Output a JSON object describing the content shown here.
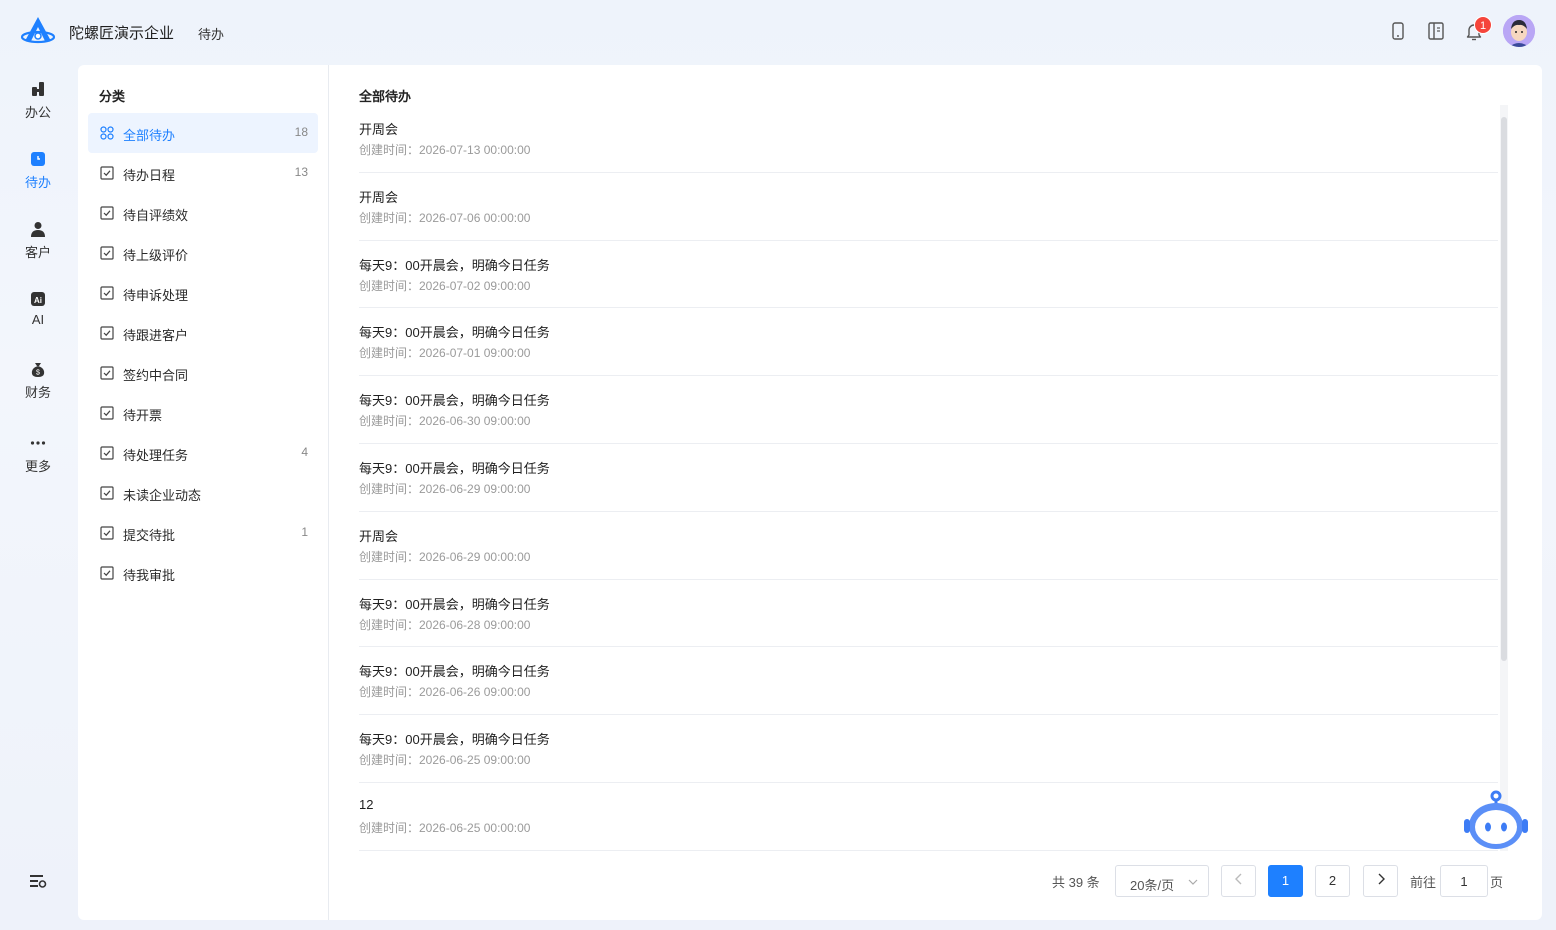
{
  "header": {
    "company": "陀螺匠演示企业",
    "breadcrumb": "待办",
    "notification_count": "1",
    "icons": [
      "phone-icon",
      "book-icon",
      "bell-icon"
    ]
  },
  "sidebar": {
    "items": [
      {
        "label": "办公",
        "icon": "office-icon"
      },
      {
        "label": "待办",
        "icon": "todo-icon",
        "active": true
      },
      {
        "label": "客户",
        "icon": "customer-icon"
      },
      {
        "label": "AI",
        "icon": "ai-icon"
      },
      {
        "label": "财务",
        "icon": "finance-icon"
      },
      {
        "label": "更多",
        "icon": "more-icon"
      }
    ]
  },
  "categories": {
    "title": "分类",
    "items": [
      {
        "label": "全部待办",
        "count": "18",
        "active": true
      },
      {
        "label": "待办日程",
        "count": "13"
      },
      {
        "label": "待自评绩效",
        "count": ""
      },
      {
        "label": "待上级评价",
        "count": ""
      },
      {
        "label": "待申诉处理",
        "count": ""
      },
      {
        "label": "待跟进客户",
        "count": ""
      },
      {
        "label": "签约中合同",
        "count": ""
      },
      {
        "label": "待开票",
        "count": ""
      },
      {
        "label": "待处理任务",
        "count": "4"
      },
      {
        "label": "未读企业动态",
        "count": ""
      },
      {
        "label": "提交待批",
        "count": "1"
      },
      {
        "label": "待我审批",
        "count": ""
      }
    ]
  },
  "todo_list": {
    "title": "全部待办",
    "items": [
      {
        "title": "开周会",
        "time": "创建时间：2026-07-13 00:00:00"
      },
      {
        "title": "开周会",
        "time": "创建时间：2026-07-06 00:00:00"
      },
      {
        "title": "每天9：00开晨会，明确今日任务",
        "time": "创建时间：2026-07-02 09:00:00"
      },
      {
        "title": "每天9：00开晨会，明确今日任务",
        "time": "创建时间：2026-07-01 09:00:00"
      },
      {
        "title": "每天9：00开晨会，明确今日任务",
        "time": "创建时间：2026-06-30 09:00:00"
      },
      {
        "title": "每天9：00开晨会，明确今日任务",
        "time": "创建时间：2026-06-29 09:00:00"
      },
      {
        "title": "开周会",
        "time": "创建时间：2026-06-29 00:00:00"
      },
      {
        "title": "每天9：00开晨会，明确今日任务",
        "time": "创建时间：2026-06-28 09:00:00"
      },
      {
        "title": "每天9：00开晨会，明确今日任务",
        "time": "创建时间：2026-06-26 09:00:00"
      },
      {
        "title": "每天9：00开晨会，明确今日任务",
        "time": "创建时间：2026-06-25 09:00:00"
      },
      {
        "title": "12",
        "time": "创建时间：2026-06-25 00:00:00"
      }
    ]
  },
  "pagination": {
    "total": "共 39 条",
    "page_size": "20条/页",
    "pages": [
      "1",
      "2"
    ],
    "current": "1",
    "goto_label": "前往",
    "goto_value": "1",
    "page_suffix": "页"
  },
  "colors": {
    "accent": "#1e80ff",
    "badge": "#f5453b"
  }
}
